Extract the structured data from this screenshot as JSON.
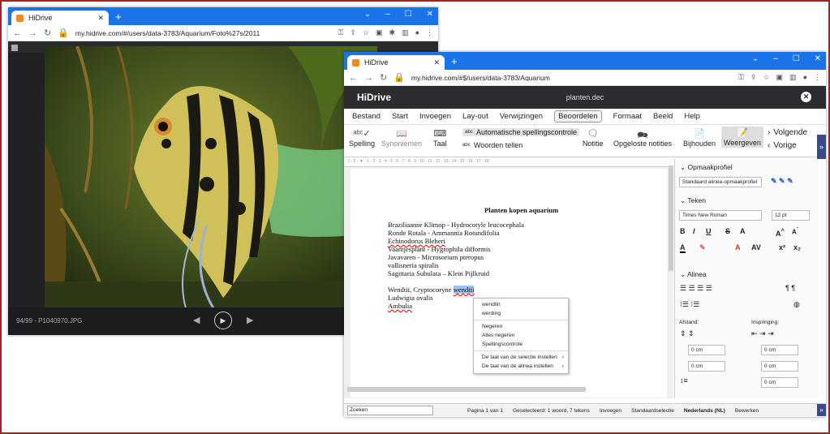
{
  "window1": {
    "tab_title": "HiDrive",
    "url": "my.hidrive.com/#/users/data-3783/Aquarium/Foto%27s/2011",
    "filename": "94/99 - P1040970.JPG"
  },
  "window2": {
    "tab_title": "HiDrive",
    "url": "my.hidrive.com/#$/users/data-3783/Aquarium",
    "app_name": "HiDrive",
    "doc_name": "planten.dec",
    "menu": [
      "Bestand",
      "Start",
      "Invoegen",
      "Lay-out",
      "Verwijzingen",
      "Beoordelen",
      "Formaat",
      "Beeld",
      "Help"
    ],
    "ribbon": {
      "spelling": "Spelling",
      "synoniemen": "Synoniemen",
      "taal": "Taal",
      "auto_spell": "Automatische spellingscontrole",
      "woorden_tellen": "Woorden tellen",
      "notitie": "Notitie",
      "opgeloste": "Opgeloste notities",
      "bijhouden": "Bijhouden",
      "weergeven": "Weergeven",
      "volgende": "Volgende",
      "vorige": "Vorige"
    },
    "document": {
      "title": "Planten kopen aquarium",
      "lines": [
        "Braziliaanse Klimop - Hydrocotyle leucocephala",
        "Ronde Rotala - Ammannia Rotundifolia",
        "Echinodorus Bleheri",
        "Vaantjesplant - Hygrophila difformis",
        "Javavaren - Microsorium pteropus",
        "vallisneria spiralis",
        "Sagittaria Subulata – Klein Pijlkruid"
      ],
      "line_wendtii_prefix": "Wendtii, Cryptocoryne",
      "line_wendtii_selected": "wendtii",
      "line_ludwigia": "Ludwigia ovalis",
      "line_ambulia": "Ambulia"
    },
    "context_menu": {
      "suggestions": [
        "wendtin",
        "werding"
      ],
      "ignore": "Negeren",
      "ignore_all": "Alles negeren",
      "spellcheck": "Spellingscontrole",
      "lang_selection": "De taal van de selectie instellen",
      "lang_paragraph": "De taal van de alinea instellen"
    },
    "sidebar": {
      "opmaakprofiel_header": "Opmaakprofiel",
      "profile_value": "Standaard alinea-opmaakprofiel",
      "teken_header": "Teken",
      "font_value": "Times New Roman",
      "size_value": "12 pt",
      "alinea_header": "Alinea",
      "afstand_label": "Afstand:",
      "inspringing_label": "Inspringing:",
      "spin_value": "0",
      "spin_unit": "cm"
    },
    "status": {
      "search_placeholder": "Zoeken",
      "page": "Pagina 1 van 1",
      "selected": "Geselecteerd: 1 woord, 7 tekens",
      "mode": "Invoegen",
      "style": "Standaardselectie",
      "language": "Nederlands (NL)",
      "edit": "Bewerken"
    }
  }
}
